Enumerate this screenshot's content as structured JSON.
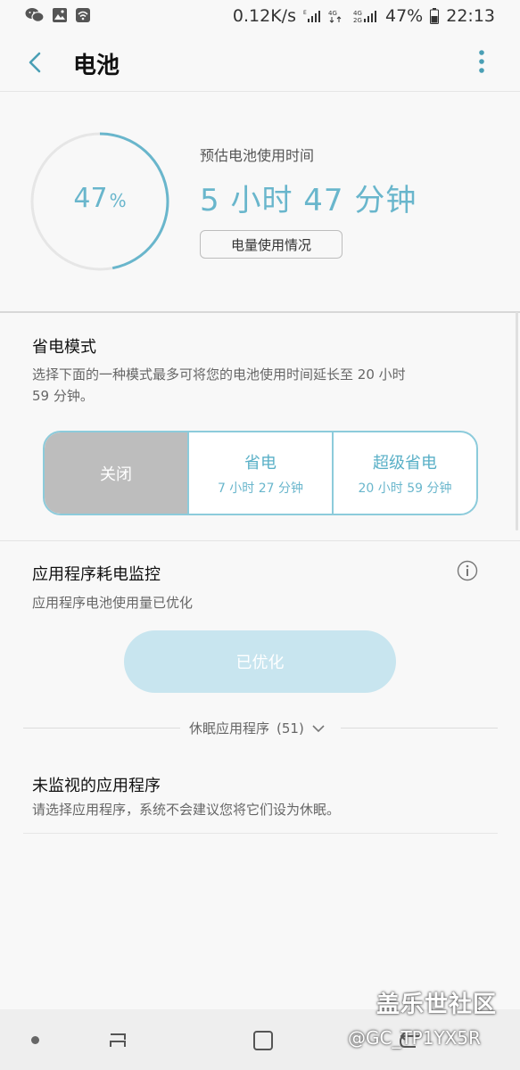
{
  "status_bar": {
    "net_speed": "0.12K/s",
    "battery_pct": "47%",
    "time": "22:13",
    "icons": [
      "wechat-icon",
      "image-icon",
      "wifi-icon",
      "signal-icon",
      "4g-icon",
      "battery-icon"
    ]
  },
  "header": {
    "title": "电池",
    "back_icon": "back-arrow-icon",
    "more_icon": "more-vertical-icon"
  },
  "battery": {
    "level_fraction": 0.47,
    "percent_value": "47",
    "percent_unit": "%",
    "estimate_label": "预估电池使用时间",
    "estimate_time": "5 小时 47 分钟",
    "usage_button": "电量使用情况"
  },
  "power_saving": {
    "title": "省电模式",
    "description": "选择下面的一种模式最多可将您的电池使用时间延长至 20 小时 59 分钟。",
    "modes": [
      {
        "name": "关闭",
        "time": "",
        "selected": true
      },
      {
        "name": "省电",
        "time": "7 小时 27 分钟",
        "selected": false
      },
      {
        "name": "超级省电",
        "time": "20 小时 59 分钟",
        "selected": false
      }
    ]
  },
  "app_monitor": {
    "title": "应用程序耗电监控",
    "description": "应用程序电池使用量已优化",
    "button": "已优化",
    "info_icon": "info-icon"
  },
  "sleeping_apps": {
    "label": "休眠应用程序",
    "count": "(51)"
  },
  "unmonitored": {
    "title": "未监视的应用程序",
    "description": "请选择应用程序，系统不会建议您将它们设为休眠。"
  },
  "watermark": {
    "title": "盖乐世社区",
    "subtitle": "@GC_TP1YX5R"
  },
  "colors": {
    "accent": "#69b6cc",
    "ring_track": "#e6e6e6",
    "mode_border": "#8ccbdb",
    "selected_mode_bg": "#bdbdbd",
    "optimized_bg": "#c8e5ef"
  }
}
